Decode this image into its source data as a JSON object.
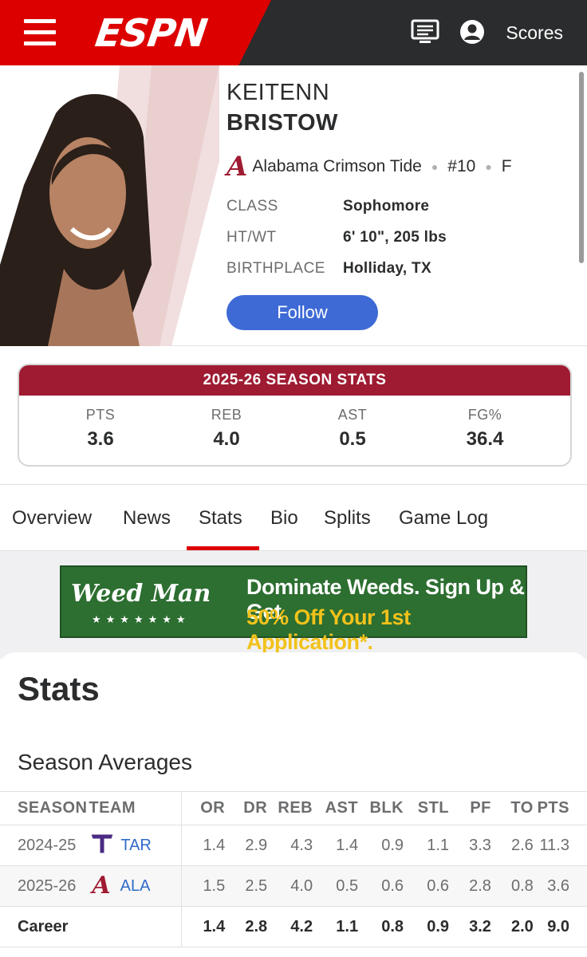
{
  "header": {
    "logo": "ESPN",
    "scores_label": "Scores",
    "icons": [
      "menu-icon",
      "news-icon",
      "account-icon"
    ]
  },
  "player": {
    "first_name": "KEITENN",
    "last_name": "BRISTOW",
    "team": "Alabama Crimson Tide",
    "number": "#10",
    "position": "F",
    "attributes": [
      {
        "label": "CLASS",
        "value": "Sophomore"
      },
      {
        "label": "HT/WT",
        "value": "6' 10\", 205 lbs"
      },
      {
        "label": "BIRTHPLACE",
        "value": "Holliday, TX"
      }
    ],
    "follow_label": "Follow"
  },
  "season_card": {
    "title": "2025-26 SEASON STATS",
    "stats": [
      {
        "label": "PTS",
        "value": "3.6"
      },
      {
        "label": "REB",
        "value": "4.0"
      },
      {
        "label": "AST",
        "value": "0.5"
      },
      {
        "label": "FG%",
        "value": "36.4"
      }
    ]
  },
  "tabs": [
    "Overview",
    "News",
    "Stats",
    "Bio",
    "Splits",
    "Game Log"
  ],
  "active_tab": "Stats",
  "ad": {
    "brand": "Weed Man",
    "line1": "Dominate Weeds. Sign Up & Get",
    "line2": "50% Off Your 1st Application*."
  },
  "stats_section": {
    "title": "Stats",
    "subtitle": "Season Averages",
    "columns": [
      "SEASON",
      "TEAM",
      "OR",
      "DR",
      "REB",
      "AST",
      "BLK",
      "STL",
      "PF",
      "TO",
      "PTS"
    ],
    "rows": [
      {
        "season": "2024-25",
        "team": "TAR",
        "values": [
          "1.4",
          "2.9",
          "4.3",
          "1.4",
          "0.9",
          "1.1",
          "3.3",
          "2.6",
          "11.3"
        ]
      },
      {
        "season": "2025-26",
        "team": "ALA",
        "values": [
          "1.5",
          "2.5",
          "4.0",
          "0.5",
          "0.6",
          "0.6",
          "2.8",
          "0.8",
          "3.6"
        ]
      }
    ],
    "career": {
      "label": "Career",
      "values": [
        "1.4",
        "2.8",
        "4.2",
        "1.1",
        "0.8",
        "0.9",
        "3.2",
        "2.0",
        "9.0"
      ]
    }
  },
  "colors": {
    "espn_red": "#dd0000",
    "header_dark": "#2b2c2d",
    "crimson": "#9e1b32",
    "follow_blue": "#3e6ad6",
    "link_blue": "#2f6bc9"
  }
}
